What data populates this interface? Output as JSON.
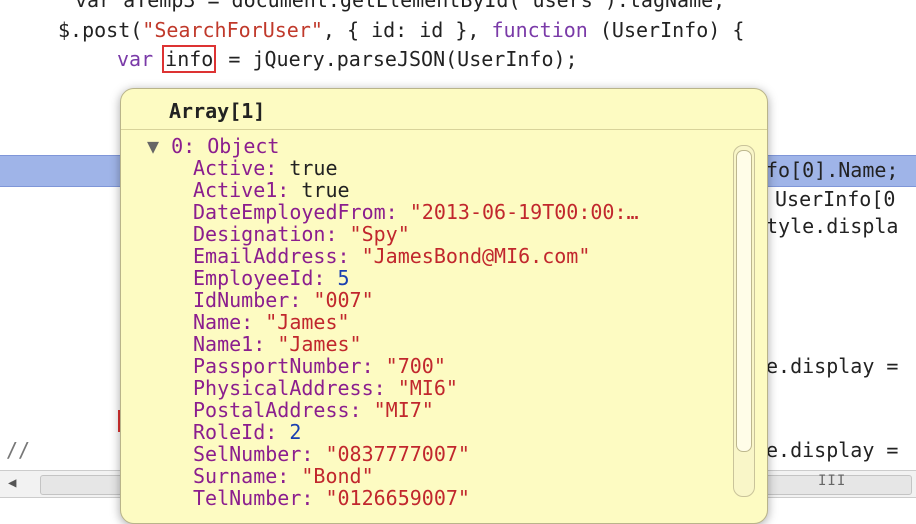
{
  "code": {
    "line0": "var aTemp3 = document.getElementById(\"users\").tagName;",
    "line1_a": "$.post(",
    "line1_b": "\"SearchForUser\"",
    "line1_c": ", { id: id }, ",
    "line1_d": "function",
    "line1_e": " (UserInfo) {",
    "line2_kw": "var",
    "line2_var": "info",
    "line2_rest": " = jQuery.parseJSON(UserInfo);",
    "r1": "fo[0].Name;",
    "r2": "UserInfo[0",
    "r3": "tyle.displa",
    "r4": "e.display =",
    "r5": "e.display =",
    "comment": "//"
  },
  "popup": {
    "title": "Array[1]",
    "root_toggle": "▼",
    "root_label": "0: Object",
    "props": [
      {
        "name": "Active",
        "value": "true",
        "type": "bool"
      },
      {
        "name": "Active1",
        "value": "true",
        "type": "bool"
      },
      {
        "name": "DateEmployedFrom",
        "value": "\"2013-06-19T00:00:…",
        "type": "str"
      },
      {
        "name": "Designation",
        "value": "\"Spy\"",
        "type": "str"
      },
      {
        "name": "EmailAddress",
        "value": "\"JamesBond@MI6.com\"",
        "type": "str"
      },
      {
        "name": "EmployeeId",
        "value": "5",
        "type": "num"
      },
      {
        "name": "IdNumber",
        "value": "\"007\"",
        "type": "str"
      },
      {
        "name": "Name",
        "value": "\"James\"",
        "type": "str"
      },
      {
        "name": "Name1",
        "value": "\"James\"",
        "type": "str"
      },
      {
        "name": "PassportNumber",
        "value": "\"700\"",
        "type": "str"
      },
      {
        "name": "PhysicalAddress",
        "value": "\"MI6\"",
        "type": "str"
      },
      {
        "name": "PostalAddress",
        "value": "\"MI7\"",
        "type": "str"
      },
      {
        "name": "RoleId",
        "value": "2",
        "type": "num"
      },
      {
        "name": "SelNumber",
        "value": "\"0837777007\"",
        "type": "str"
      },
      {
        "name": "Surname",
        "value": "\"Bond\"",
        "type": "str"
      },
      {
        "name": "TelNumber",
        "value": "\"0126659007\"",
        "type": "str"
      }
    ]
  },
  "scrollbar": {
    "left_arrow": "◀",
    "grip": "III"
  },
  "colors": {
    "popup_bg": "#fdfbc2",
    "highlight": "#9fb4e8",
    "string": "#c1272d",
    "property": "#8b1e8e",
    "number": "#1a3fb0"
  }
}
